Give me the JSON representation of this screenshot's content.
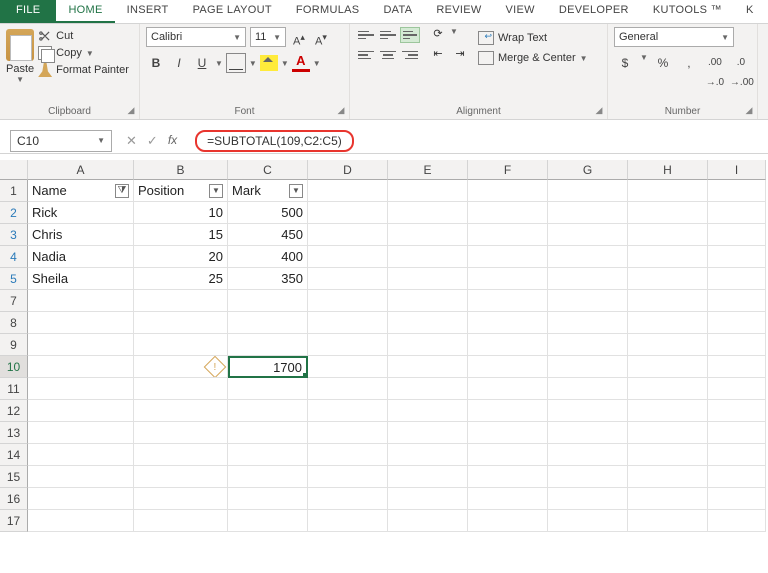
{
  "tabs": {
    "file": "FILE",
    "home": "HOME",
    "insert": "INSERT",
    "pagelayout": "PAGE LAYOUT",
    "formulas": "FORMULAS",
    "data": "DATA",
    "review": "REVIEW",
    "view": "VIEW",
    "developer": "DEVELOPER",
    "kutools": "KUTOOLS ™",
    "k": "K"
  },
  "clipboard": {
    "paste": "Paste",
    "cut": "Cut",
    "copy": "Copy",
    "fmt": "Format Painter",
    "label": "Clipboard"
  },
  "font": {
    "name": "Calibri",
    "size": "11",
    "label": "Font"
  },
  "align": {
    "wrap": "Wrap Text",
    "merge": "Merge & Center",
    "label": "Alignment"
  },
  "number": {
    "format": "General",
    "label": "Number"
  },
  "fbar": {
    "cellref": "C10",
    "formula": "=SUBTOTAL(109,C2:C5)"
  },
  "cols": [
    "A",
    "B",
    "C",
    "D",
    "E",
    "F",
    "G",
    "H",
    "I"
  ],
  "headers": {
    "a": "Name",
    "b": "Position",
    "c": "Mark"
  },
  "rows": [
    {
      "n": "2",
      "a": "Rick",
      "b": "10",
      "c": "500"
    },
    {
      "n": "3",
      "a": "Chris",
      "b": "15",
      "c": "450"
    },
    {
      "n": "4",
      "a": "Nadia",
      "b": "20",
      "c": "400"
    },
    {
      "n": "5",
      "a": "Sheila",
      "b": "25",
      "c": "350"
    }
  ],
  "result": {
    "row": "10",
    "value": "1700"
  },
  "emptyrows": [
    "7",
    "8",
    "9"
  ],
  "tailrows": [
    "11",
    "12",
    "13",
    "14",
    "15",
    "16",
    "17"
  ]
}
